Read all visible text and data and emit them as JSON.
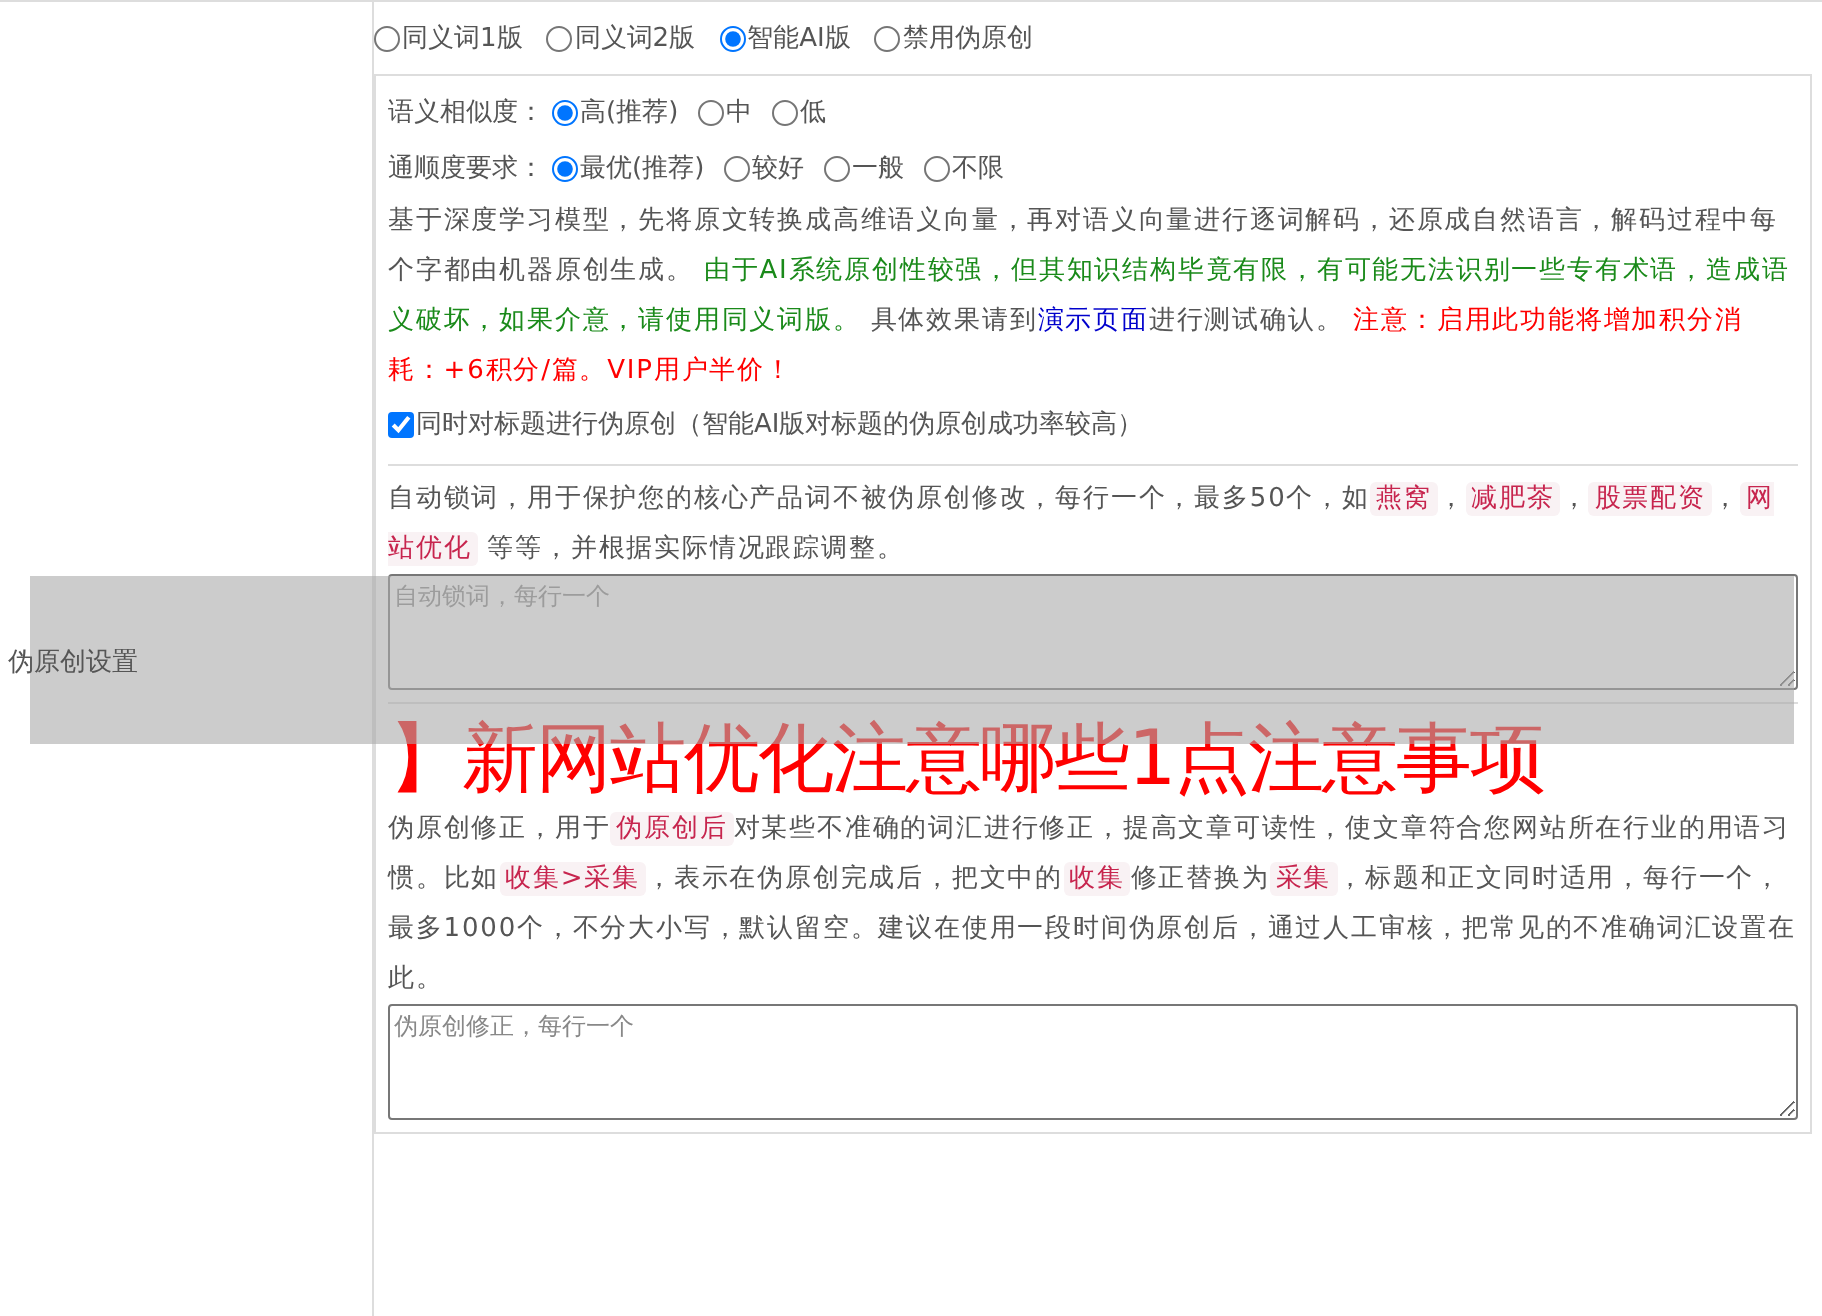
{
  "form_label": "伪原创设置",
  "mode_options": [
    {
      "label": "同义词1版",
      "selected": false
    },
    {
      "label": "同义词2版",
      "selected": false
    },
    {
      "label": "智能AI版",
      "selected": true
    },
    {
      "label": "禁用伪原创",
      "selected": false
    }
  ],
  "ai_settings": {
    "similarity": {
      "label": "语义相似度：",
      "options": [
        {
          "label": "高(推荐)",
          "selected": true
        },
        {
          "label": "中",
          "selected": false
        },
        {
          "label": "低",
          "selected": false
        }
      ]
    },
    "fluency": {
      "label": "通顺度要求：",
      "options": [
        {
          "label": "最优(推荐)",
          "selected": true
        },
        {
          "label": "较好",
          "selected": false
        },
        {
          "label": "一般",
          "selected": false
        },
        {
          "label": "不限",
          "selected": false
        }
      ]
    },
    "description": [
      {
        "kind": "normal",
        "text": "基于深度学习模型，先将原文转换成高维语义向量，再对语义向量进行逐词解码，还原成自然语言，解码过程中每个字都由机器原创生成。 "
      },
      {
        "kind": "notice",
        "text": "由于AI系统原创性较强，但其知识结构毕竟有限，有可能无法识别一些专有术语，造成语义破坏，如果介意，请使用同义词版。"
      },
      {
        "kind": "normal",
        "text": " 具体效果请到"
      },
      {
        "kind": "link",
        "text": "演示页面"
      },
      {
        "kind": "normal",
        "text": "进行测试确认。 "
      },
      {
        "kind": "warning",
        "text": "注意：启用此功能将增加积分消耗：+6积分/篇。VIP用户半价！"
      }
    ],
    "title_option": {
      "label": "同时对标题进行伪原创（智能AI版对标题的伪原创成功率较高）",
      "checked": true
    }
  },
  "lock_words": {
    "description": [
      {
        "kind": "normal",
        "text": "自动锁词，用于保护您的核心产品词不被伪原创修改，每行一个，最多50个，如"
      },
      {
        "kind": "code",
        "text": "燕窝"
      },
      {
        "kind": "normal",
        "text": "，"
      },
      {
        "kind": "code",
        "text": "减肥茶"
      },
      {
        "kind": "normal",
        "text": "，"
      },
      {
        "kind": "code",
        "text": "股票配资"
      },
      {
        "kind": "normal",
        "text": "，"
      },
      {
        "kind": "code",
        "text": "网站优化"
      },
      {
        "kind": "normal",
        "text": " 等等，并根据实际情况跟踪调整。"
      }
    ],
    "placeholder": "自动锁词，每行一个"
  },
  "correction": {
    "description": [
      {
        "kind": "normal",
        "text": "伪原创修正，用于"
      },
      {
        "kind": "code",
        "text": "伪原创后"
      },
      {
        "kind": "normal",
        "text": "对某些不准确的词汇进行修正，提高文章可读性，使文章符合您网站所在行业的用语习惯。比如"
      },
      {
        "kind": "code",
        "text": "收集>采集"
      },
      {
        "kind": "normal",
        "text": "，表示在伪原创完成后，把文中的"
      },
      {
        "kind": "code",
        "text": "收集"
      },
      {
        "kind": "normal",
        "text": "修正替换为"
      },
      {
        "kind": "code",
        "text": "采集"
      },
      {
        "kind": "normal",
        "text": "，标题和正文同时适用，每行一个，最多1000个，不分大小写，默认留空。建议在使用一段时间伪原创后，通过人工审核，把常见的不准确词汇设置在此。"
      }
    ],
    "placeholder": "伪原创修正，每行一个"
  },
  "overlay_title": "】新网站优化注意哪些1点注意事项"
}
